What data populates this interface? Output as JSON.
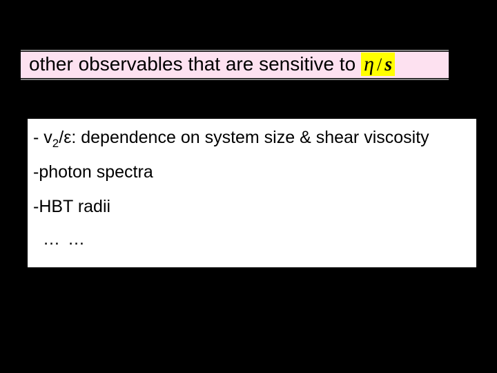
{
  "title": {
    "prefix": "other observables that are sensitive to ",
    "eta": "η",
    "slash": "/",
    "s": "s"
  },
  "items": {
    "i1_pre": "- v",
    "i1_sub": "2",
    "i1_post": "/ε: dependence on system size & shear viscosity",
    "i2": "-photon spectra",
    "i3": "-HBT radii",
    "dots": "…  …"
  }
}
